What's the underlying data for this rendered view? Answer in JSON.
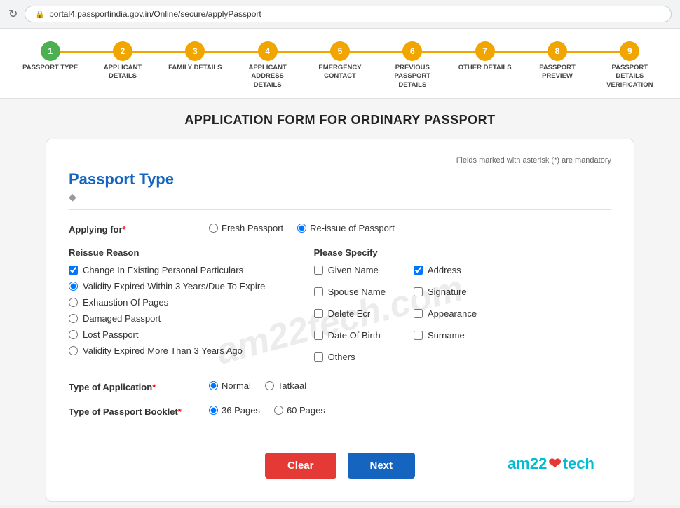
{
  "browser": {
    "url": "portal4.passportindia.gov.in/Online/secure/applyPassport"
  },
  "stepper": {
    "steps": [
      {
        "number": "1",
        "label": "PASSPORT TYPE",
        "active": true
      },
      {
        "number": "2",
        "label": "APPLICANT DETAILS",
        "active": false
      },
      {
        "number": "3",
        "label": "FAMILY DETAILS",
        "active": false
      },
      {
        "number": "4",
        "label": "APPLICANT ADDRESS DETAILS",
        "active": false
      },
      {
        "number": "5",
        "label": "EMERGENCY CONTACT",
        "active": false
      },
      {
        "number": "6",
        "label": "PREVIOUS PASSPORT DETAILS",
        "active": false
      },
      {
        "number": "7",
        "label": "OTHER DETAILS",
        "active": false
      },
      {
        "number": "8",
        "label": "PASSPORT PREVIEW",
        "active": false
      },
      {
        "number": "9",
        "label": "PASSPORT DETAILS VERIFICATION",
        "active": false
      }
    ]
  },
  "page_title": "APPLICATION FORM FOR ORDINARY PASSPORT",
  "mandatory_note": "Fields marked with asterisk (*) are mandatory",
  "form": {
    "section_title": "Passport Type",
    "applying_for_label": "Applying for",
    "applying_for_options": [
      {
        "label": "Fresh Passport",
        "checked": false
      },
      {
        "label": "Re-issue of Passport",
        "checked": true
      }
    ],
    "reissue_reason_title": "Reissue Reason",
    "reissue_reasons": [
      {
        "label": "Change In Existing Personal Particulars",
        "type": "checkbox",
        "checked": true
      },
      {
        "label": "Validity Expired Within 3 Years/Due To Expire",
        "type": "radio",
        "checked": true
      },
      {
        "label": "Exhaustion Of Pages",
        "type": "radio",
        "checked": false
      },
      {
        "label": "Damaged Passport",
        "type": "radio",
        "checked": false
      },
      {
        "label": "Lost Passport",
        "type": "radio",
        "checked": false
      },
      {
        "label": "Validity Expired More Than 3 Years Ago",
        "type": "radio",
        "checked": false
      }
    ],
    "please_specify_title": "Please Specify",
    "specify_col1": [
      {
        "label": "Given Name",
        "checked": false
      },
      {
        "label": "Spouse Name",
        "checked": false
      },
      {
        "label": "Delete Ecr",
        "checked": false
      },
      {
        "label": "Date Of Birth",
        "checked": false
      },
      {
        "label": "Others",
        "checked": false
      }
    ],
    "specify_col2": [
      {
        "label": "Address",
        "checked": true
      },
      {
        "label": "Signature",
        "checked": false
      },
      {
        "label": "Appearance",
        "checked": false
      },
      {
        "label": "Surname",
        "checked": false
      }
    ],
    "type_of_application_label": "Type of Application",
    "type_of_application_options": [
      {
        "label": "Normal",
        "checked": true
      },
      {
        "label": "Tatkaal",
        "checked": false
      }
    ],
    "type_of_booklet_label": "Type of Passport Booklet",
    "type_of_booklet_options": [
      {
        "label": "36 Pages",
        "checked": true
      },
      {
        "label": "60 Pages",
        "checked": false
      }
    ],
    "clear_button": "Clear",
    "next_button": "Next"
  },
  "watermark": "am22tech.com",
  "brand": {
    "text_before": "am22",
    "text_after": "tech",
    "heart": "❤"
  }
}
